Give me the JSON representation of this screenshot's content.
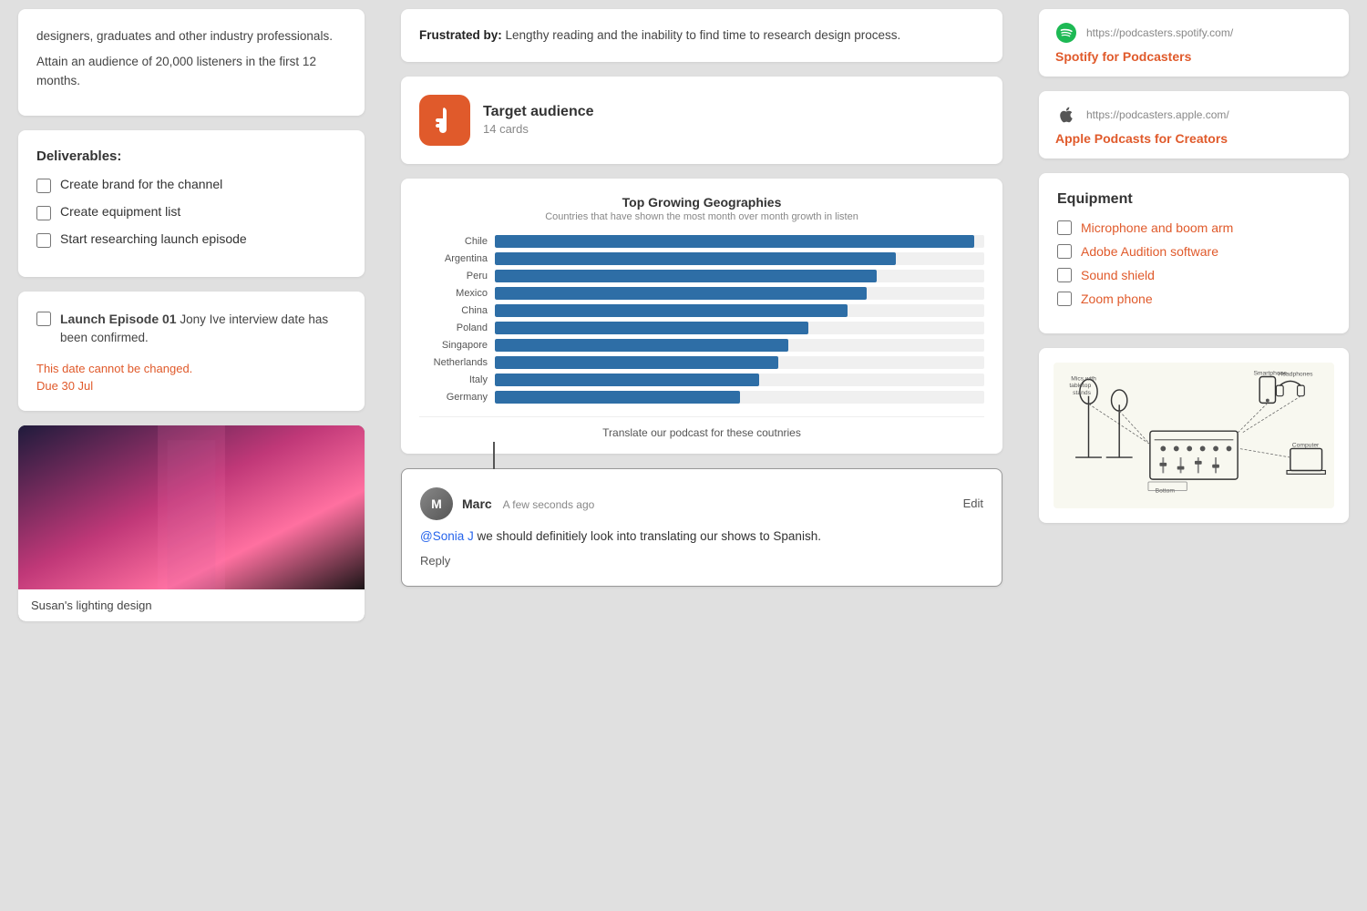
{
  "left": {
    "audience_text1": "designers, graduates and other industry professionals.",
    "audience_text2": "Attain an audience of 20,000 listeners in the first 12 months.",
    "deliverables": {
      "title": "Deliverables:",
      "items": [
        {
          "label": "Create brand for the channel",
          "checked": false
        },
        {
          "label": "Create equipment list",
          "checked": false
        },
        {
          "label": "Start researching launch episode",
          "checked": false
        }
      ]
    },
    "launch_episode": {
      "title": "Launch Episode 01",
      "body": " Jony Ive interview date has been confirmed.",
      "warning": "This date cannot be changed.",
      "due": "Due 30 Jul"
    },
    "image": {
      "label": "Susan's lighting design"
    }
  },
  "middle": {
    "frustrated": {
      "bold_label": "Frustrated by:",
      "text": " Lengthy reading and the inability to find time to research design process."
    },
    "target_audience": {
      "title": "Target audience",
      "subtitle": "14 cards",
      "icon_label": "hand-icon"
    },
    "chart": {
      "title": "Top Growing Geographies",
      "subtitle": "Countries that have shown the most month over month growth in listen",
      "bars": [
        {
          "label": "Chile",
          "percent": 98
        },
        {
          "label": "Argentina",
          "percent": 82
        },
        {
          "label": "Peru",
          "percent": 78
        },
        {
          "label": "Mexico",
          "percent": 76
        },
        {
          "label": "China",
          "percent": 72
        },
        {
          "label": "Poland",
          "percent": 64
        },
        {
          "label": "Singapore",
          "percent": 60
        },
        {
          "label": "Netherlands",
          "percent": 58
        },
        {
          "label": "Italy",
          "percent": 54
        },
        {
          "label": "Germany",
          "percent": 50
        }
      ],
      "annotation": "Translate our podcast for these coutnries"
    },
    "comment": {
      "author": "Marc",
      "avatar_letter": "M",
      "time": "A few seconds ago",
      "edit_label": "Edit",
      "mention": "@Sonia J",
      "body": " we should definitiely look into translating our shows to Spanish.",
      "reply_label": "Reply"
    }
  },
  "right": {
    "spotify": {
      "url": "https://podcasters.spotify.com/",
      "link_text": "Spotify for Podcasters",
      "icon": "spotify-icon"
    },
    "apple": {
      "url": "https://podcasters.apple.com/",
      "link_text": "Apple Podcasts for Creators",
      "icon": "apple-icon"
    },
    "equipment": {
      "title": "Equipment",
      "items": [
        {
          "label": "Microphone and boom arm",
          "checked": false
        },
        {
          "label": "Adobe Audition software",
          "checked": false
        },
        {
          "label": "Sound shield",
          "checked": false
        },
        {
          "label": "Zoom phone",
          "checked": false
        }
      ]
    },
    "diagram_alt": "Equipment connection diagram"
  }
}
